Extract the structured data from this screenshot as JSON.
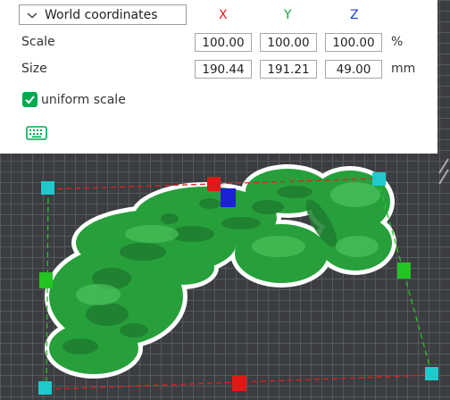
{
  "coordinate_select": {
    "value": "World coordinates"
  },
  "axes": {
    "x": "X",
    "y": "Y",
    "z": "Z"
  },
  "scale": {
    "label": "Scale",
    "x": "100.00",
    "y": "100.00",
    "z": "100.00",
    "unit": "%"
  },
  "size": {
    "label": "Size",
    "x": "190.44",
    "y": "191.21",
    "z": "49.00",
    "unit": "mm"
  },
  "uniform_scale": {
    "label": "uniform scale",
    "checked": true
  },
  "colors": {
    "accent": "#00a94f",
    "axis_x": "#e61c1c",
    "axis_y": "#1aa13b",
    "axis_z": "#1d3fd8",
    "model": "#27a03c",
    "bed": "#3b3d40"
  },
  "icons": [
    "chevron-down-icon",
    "checkmark-icon",
    "keyboard-icon"
  ]
}
